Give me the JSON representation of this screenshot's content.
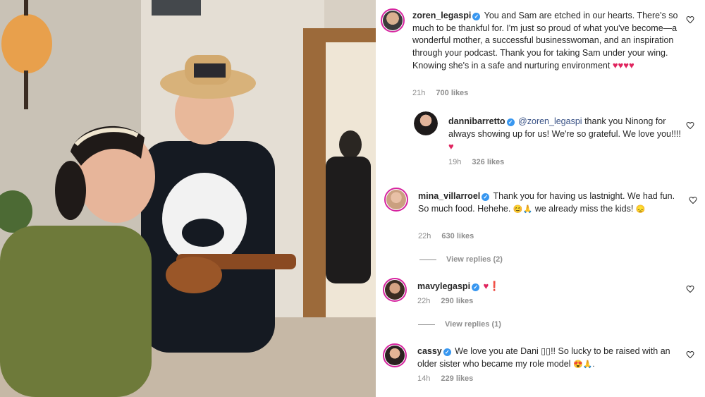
{
  "comments": [
    {
      "username": "zoren_legaspi",
      "verified": true,
      "text": "You and Sam are etched in our hearts. There's so much to be thankful for. I'm just so proud of what you've become—a wonderful mother, a successful businesswoman, and an inspiration through your podcast. Thank you for taking Sam under your wing. Knowing she's in a safe and nurturing environment",
      "emoji": "♥♥♥♥",
      "time": "21h",
      "likes": "700 likes",
      "reply": {
        "username": "dannibarretto",
        "verified": true,
        "mention": "@zoren_legaspi",
        "text": "thank you Ninong for always showing up for us! We're so grateful. We love you!!!!",
        "emoji": "♥",
        "time": "19h",
        "likes": "326 likes"
      }
    },
    {
      "username": "mina_villarroel",
      "verified": true,
      "text": "Thank you for having us lastnight. We had fun. So much food. Hehehe.",
      "emoji_mid": "😊🙏",
      "text2": "we already miss the kids!",
      "emoji_end": "😞",
      "time": "22h",
      "likes": "630 likes",
      "view_replies": "View replies (2)"
    },
    {
      "username": "mavylegaspi",
      "verified": true,
      "emoji": "♥❗",
      "time": "22h",
      "likes": "290 likes",
      "view_replies": "View replies (1)"
    },
    {
      "username": "cassy",
      "verified": true,
      "text": "We love you ate Dani ▯▯!! So lucky to be raised with an older sister who became my role model",
      "emoji": "😍🙏.",
      "time": "14h",
      "likes": "229 likes"
    }
  ]
}
